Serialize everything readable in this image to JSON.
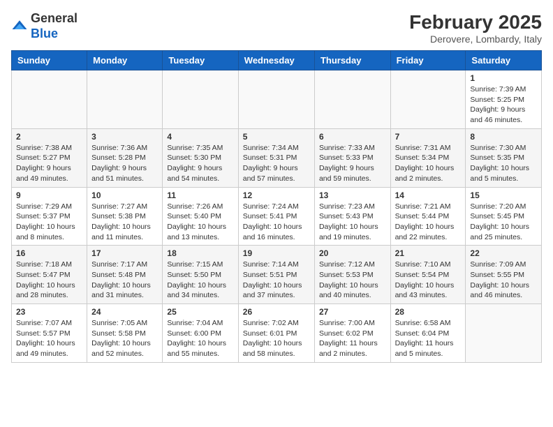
{
  "header": {
    "logo_line1": "General",
    "logo_line2": "Blue",
    "month_year": "February 2025",
    "location": "Derovere, Lombardy, Italy"
  },
  "weekdays": [
    "Sunday",
    "Monday",
    "Tuesday",
    "Wednesday",
    "Thursday",
    "Friday",
    "Saturday"
  ],
  "weeks": [
    [
      {
        "num": "",
        "info": ""
      },
      {
        "num": "",
        "info": ""
      },
      {
        "num": "",
        "info": ""
      },
      {
        "num": "",
        "info": ""
      },
      {
        "num": "",
        "info": ""
      },
      {
        "num": "",
        "info": ""
      },
      {
        "num": "1",
        "info": "Sunrise: 7:39 AM\nSunset: 5:25 PM\nDaylight: 9 hours and 46 minutes."
      }
    ],
    [
      {
        "num": "2",
        "info": "Sunrise: 7:38 AM\nSunset: 5:27 PM\nDaylight: 9 hours and 49 minutes."
      },
      {
        "num": "3",
        "info": "Sunrise: 7:36 AM\nSunset: 5:28 PM\nDaylight: 9 hours and 51 minutes."
      },
      {
        "num": "4",
        "info": "Sunrise: 7:35 AM\nSunset: 5:30 PM\nDaylight: 9 hours and 54 minutes."
      },
      {
        "num": "5",
        "info": "Sunrise: 7:34 AM\nSunset: 5:31 PM\nDaylight: 9 hours and 57 minutes."
      },
      {
        "num": "6",
        "info": "Sunrise: 7:33 AM\nSunset: 5:33 PM\nDaylight: 9 hours and 59 minutes."
      },
      {
        "num": "7",
        "info": "Sunrise: 7:31 AM\nSunset: 5:34 PM\nDaylight: 10 hours and 2 minutes."
      },
      {
        "num": "8",
        "info": "Sunrise: 7:30 AM\nSunset: 5:35 PM\nDaylight: 10 hours and 5 minutes."
      }
    ],
    [
      {
        "num": "9",
        "info": "Sunrise: 7:29 AM\nSunset: 5:37 PM\nDaylight: 10 hours and 8 minutes."
      },
      {
        "num": "10",
        "info": "Sunrise: 7:27 AM\nSunset: 5:38 PM\nDaylight: 10 hours and 11 minutes."
      },
      {
        "num": "11",
        "info": "Sunrise: 7:26 AM\nSunset: 5:40 PM\nDaylight: 10 hours and 13 minutes."
      },
      {
        "num": "12",
        "info": "Sunrise: 7:24 AM\nSunset: 5:41 PM\nDaylight: 10 hours and 16 minutes."
      },
      {
        "num": "13",
        "info": "Sunrise: 7:23 AM\nSunset: 5:43 PM\nDaylight: 10 hours and 19 minutes."
      },
      {
        "num": "14",
        "info": "Sunrise: 7:21 AM\nSunset: 5:44 PM\nDaylight: 10 hours and 22 minutes."
      },
      {
        "num": "15",
        "info": "Sunrise: 7:20 AM\nSunset: 5:45 PM\nDaylight: 10 hours and 25 minutes."
      }
    ],
    [
      {
        "num": "16",
        "info": "Sunrise: 7:18 AM\nSunset: 5:47 PM\nDaylight: 10 hours and 28 minutes."
      },
      {
        "num": "17",
        "info": "Sunrise: 7:17 AM\nSunset: 5:48 PM\nDaylight: 10 hours and 31 minutes."
      },
      {
        "num": "18",
        "info": "Sunrise: 7:15 AM\nSunset: 5:50 PM\nDaylight: 10 hours and 34 minutes."
      },
      {
        "num": "19",
        "info": "Sunrise: 7:14 AM\nSunset: 5:51 PM\nDaylight: 10 hours and 37 minutes."
      },
      {
        "num": "20",
        "info": "Sunrise: 7:12 AM\nSunset: 5:53 PM\nDaylight: 10 hours and 40 minutes."
      },
      {
        "num": "21",
        "info": "Sunrise: 7:10 AM\nSunset: 5:54 PM\nDaylight: 10 hours and 43 minutes."
      },
      {
        "num": "22",
        "info": "Sunrise: 7:09 AM\nSunset: 5:55 PM\nDaylight: 10 hours and 46 minutes."
      }
    ],
    [
      {
        "num": "23",
        "info": "Sunrise: 7:07 AM\nSunset: 5:57 PM\nDaylight: 10 hours and 49 minutes."
      },
      {
        "num": "24",
        "info": "Sunrise: 7:05 AM\nSunset: 5:58 PM\nDaylight: 10 hours and 52 minutes."
      },
      {
        "num": "25",
        "info": "Sunrise: 7:04 AM\nSunset: 6:00 PM\nDaylight: 10 hours and 55 minutes."
      },
      {
        "num": "26",
        "info": "Sunrise: 7:02 AM\nSunset: 6:01 PM\nDaylight: 10 hours and 58 minutes."
      },
      {
        "num": "27",
        "info": "Sunrise: 7:00 AM\nSunset: 6:02 PM\nDaylight: 11 hours and 2 minutes."
      },
      {
        "num": "28",
        "info": "Sunrise: 6:58 AM\nSunset: 6:04 PM\nDaylight: 11 hours and 5 minutes."
      },
      {
        "num": "",
        "info": ""
      }
    ]
  ]
}
